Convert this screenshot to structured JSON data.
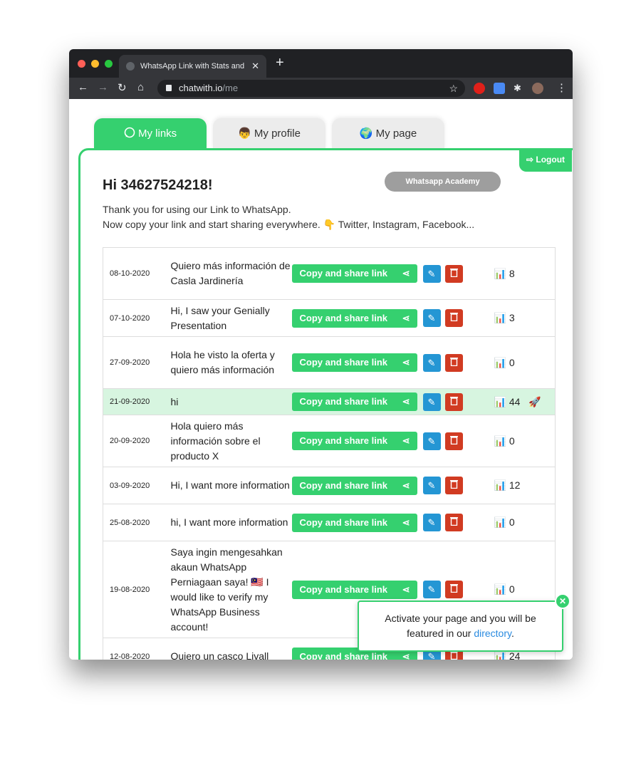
{
  "browser": {
    "tab_title": "WhatsApp Link with Stats and",
    "url_host": "chatwith.io",
    "url_path": "/me",
    "new_tab": "+",
    "close": "✕"
  },
  "tabs": [
    {
      "label": "My links",
      "icon": "whatsapp-icon"
    },
    {
      "label": "My profile",
      "icon": "👦"
    },
    {
      "label": "My page",
      "icon": "🌍"
    }
  ],
  "header": {
    "logout": "Logout",
    "greeting": "Hi 34627524218!",
    "academy": "Whatsapp Academy",
    "intro_line1": "Thank you for using our Link to WhatsApp.",
    "intro_line2": "Now copy your link and start sharing everywhere. 👇 Twitter, Instagram, Facebook..."
  },
  "copy_label": "Copy and share link",
  "links": [
    {
      "date": "08-10-2020",
      "message": "Quiero más información de Casla Jardinería",
      "views": "8"
    },
    {
      "date": "07-10-2020",
      "message": "Hi, I saw your Genially Presentation",
      "views": "3"
    },
    {
      "date": "27-09-2020",
      "message": "Hola he visto la oferta y quiero más información",
      "views": "0"
    },
    {
      "date": "21-09-2020",
      "message": "hi",
      "views": "44",
      "badge": "🚀",
      "highlighted": true
    },
    {
      "date": "20-09-2020",
      "message": "Hola quiero más información sobre el producto X",
      "views": "0"
    },
    {
      "date": "03-09-2020",
      "message": "Hi, I want more information",
      "views": "12"
    },
    {
      "date": "25-08-2020",
      "message": "hi, I want more information",
      "views": "0"
    },
    {
      "date": "19-08-2020",
      "message": "Saya ingin mengesahkan akaun WhatsApp Perniagaan saya! 🇲🇾 I would like to verify my WhatsApp Business account!",
      "views": "0"
    },
    {
      "date": "12-08-2020",
      "message": "Quiero un casco Livall",
      "views": "24"
    }
  ],
  "popup": {
    "text": "Activate your page and you will be featured in our",
    "link": "directory",
    "end": "."
  },
  "colors": {
    "accent": "#35d06f",
    "edit": "#2496d4",
    "delete": "#d13b22",
    "highlight": "#d7f5e0"
  }
}
